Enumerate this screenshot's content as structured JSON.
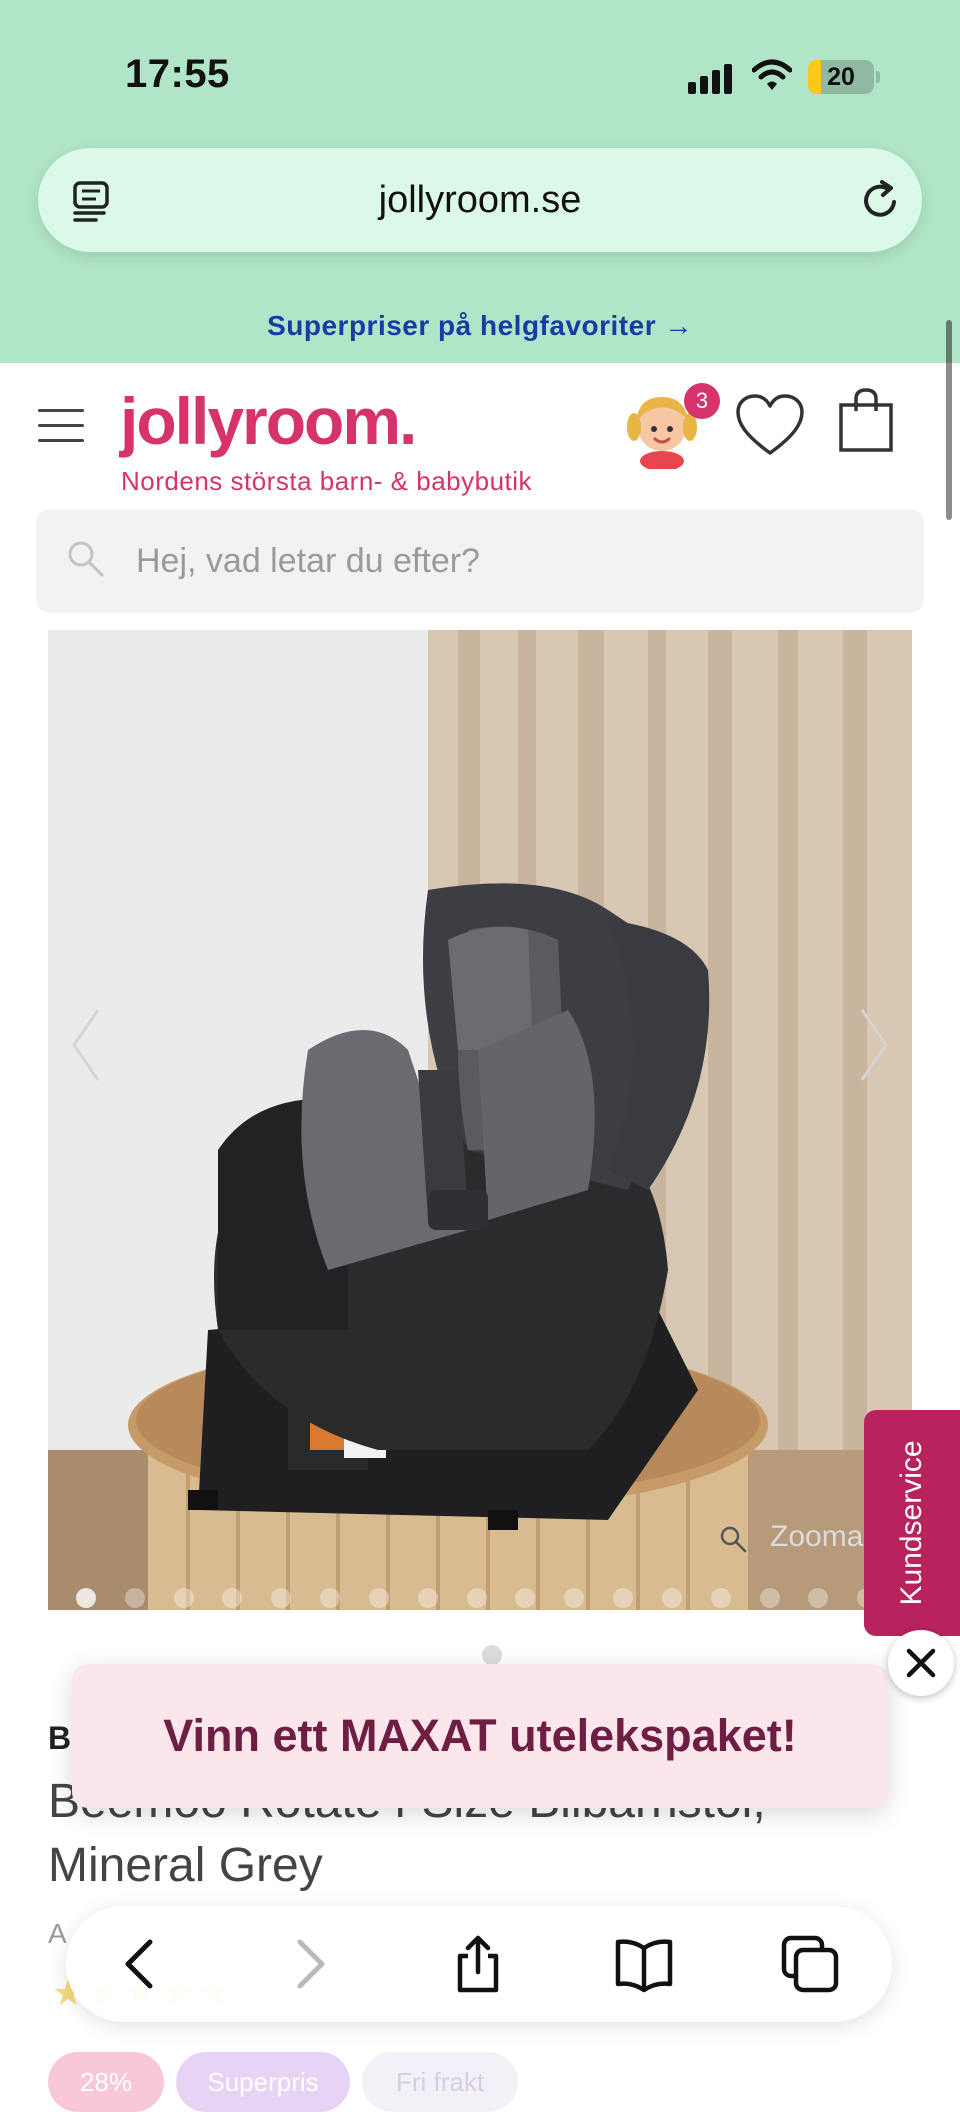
{
  "status_bar": {
    "time": "17:55",
    "battery": "20",
    "battery_level": 0.2
  },
  "browser": {
    "url": "jollyroom.se"
  },
  "promo_banner": {
    "text": "Superpriser på helgfavoriter →"
  },
  "header": {
    "logo": "jollyroom.",
    "tagline": "Nordens största barn- & babybutik",
    "avatar_badge": "3",
    "search_placeholder": "Hej, vad letar du efter?",
    "brand_color": "#d6336c"
  },
  "gallery": {
    "zoom_label": "Zooma",
    "image_count": 17,
    "active_index": 0
  },
  "customer_service_tab": {
    "label": "Kundservice",
    "color": "#b8235d"
  },
  "product": {
    "brand": "B",
    "title": "Beemoo Rotate i-Size Bilbarnstol, Mineral Grey",
    "article_prefix": "A",
    "tags": [
      "28%",
      "Superpris",
      "Fri frakt"
    ]
  },
  "popup": {
    "text": "Vinn ett MAXAT utelekspaket!"
  },
  "toolbar": {
    "icons": [
      "back-arrow-icon",
      "forward-arrow-icon",
      "share-icon",
      "bookmarks-icon",
      "tabs-icon"
    ]
  }
}
